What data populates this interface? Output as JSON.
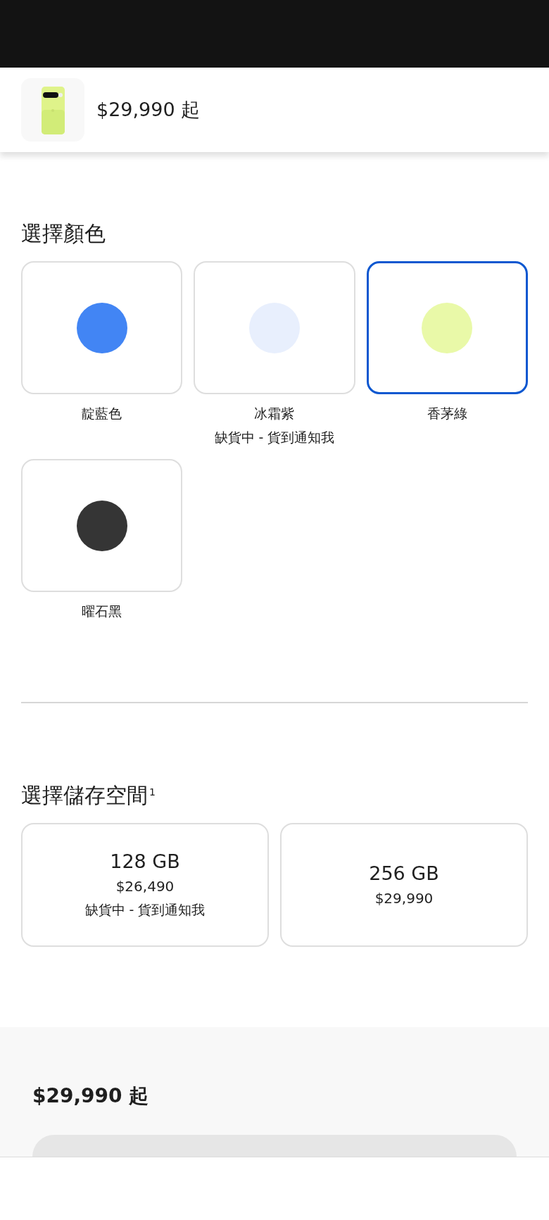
{
  "header": {
    "price": "$29,990 起"
  },
  "color_section": {
    "title": "選擇顏色",
    "options": [
      {
        "name": "靛藍色",
        "color": "#4285f4",
        "selected": false
      },
      {
        "name": "冰霜紫",
        "color": "#e8effd",
        "selected": false,
        "note": "缺貨中 - 貨到通知我"
      },
      {
        "name": "香茅綠",
        "color": "#e9f9a8",
        "selected": true
      },
      {
        "name": "曜石黑",
        "color": "#353535",
        "selected": false
      }
    ]
  },
  "storage_section": {
    "title": "選擇儲存空間$^{1}$",
    "options": [
      {
        "capacity": "128 GB",
        "price": "$26,490",
        "note": "缺貨中 - 貨到通知我",
        "selected": false
      },
      {
        "capacity": "256 GB",
        "price": "$29,990",
        "selected": false
      }
    ]
  },
  "summary": {
    "price": "$29,990 起"
  }
}
